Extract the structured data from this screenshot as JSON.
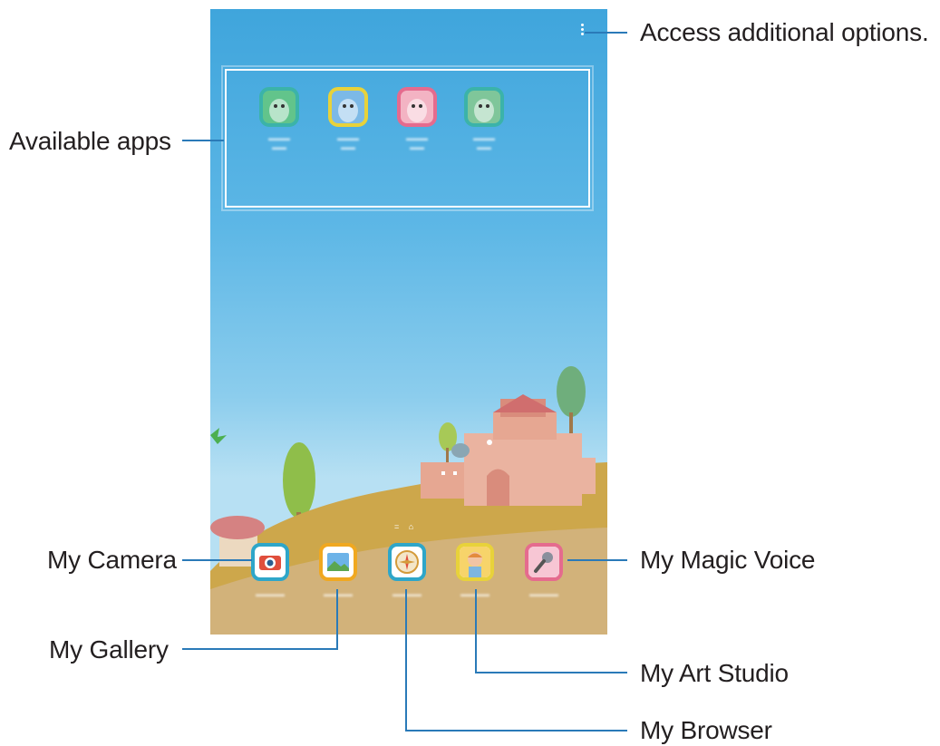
{
  "callouts": {
    "access_options": "Access additional options.",
    "available_apps": "Available apps",
    "my_camera": "My Camera",
    "my_gallery": "My Gallery",
    "my_magic_voice": "My Magic Voice",
    "my_art_studio": "My Art Studio",
    "my_browser": "My Browser"
  },
  "colors": {
    "callout_line": "#2a7ab8",
    "sky_top": "#3fa5dc",
    "sky_bottom": "#b7e0f3",
    "hill": "#c9a94e",
    "ground": "#d4b78a"
  },
  "available_apps": [
    {
      "icon": "dinosaur-character-icon",
      "border": "#3bb3a9",
      "fill": "#62c48b"
    },
    {
      "icon": "pink-character-icon",
      "border": "#e8d23a",
      "fill": "#7cb9e6"
    },
    {
      "icon": "bird-character-icon",
      "border": "#e56b8e",
      "fill": "#f3b3c3"
    },
    {
      "icon": "dinosaur-chef-icon",
      "border": "#3bb3a9",
      "fill": "#7fc69a"
    }
  ],
  "dock_apps": [
    {
      "name": "My Camera",
      "icon": "camera-icon",
      "border": "#2ea6c9"
    },
    {
      "name": "My Gallery",
      "icon": "gallery-icon",
      "border": "#f0a820"
    },
    {
      "name": "My Browser",
      "icon": "browser-icon",
      "border": "#2ea6c9"
    },
    {
      "name": "My Art Studio",
      "icon": "art-studio-icon",
      "border": "#e8d23a"
    },
    {
      "name": "My Magic Voice",
      "icon": "microphone-icon",
      "border": "#e56b8e"
    }
  ]
}
